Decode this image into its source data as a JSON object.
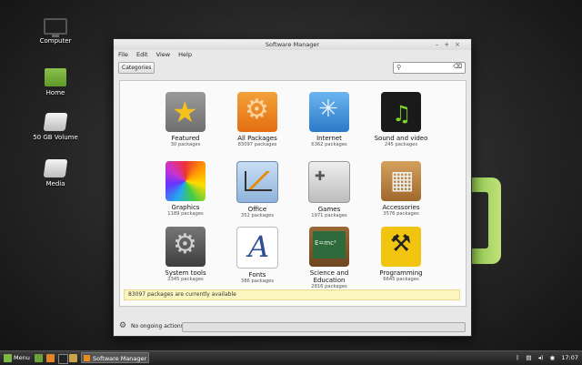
{
  "desktop": {
    "icons": [
      {
        "label": "Computer"
      },
      {
        "label": "Home"
      },
      {
        "label": "50 GB Volume"
      },
      {
        "label": "Media"
      }
    ]
  },
  "window": {
    "title": "Software Manager",
    "controls": [
      "–",
      "+",
      "×"
    ]
  },
  "menubar": {
    "items": [
      "File",
      "Edit",
      "View",
      "Help"
    ]
  },
  "toolbar": {
    "categories_label": "Categories",
    "search_placeholder": ""
  },
  "categories": [
    {
      "name": "Featured",
      "count": "30 packages"
    },
    {
      "name": "All Packages",
      "count": "83097 packages"
    },
    {
      "name": "Internet",
      "count": "6362 packages"
    },
    {
      "name": "Sound and video",
      "count": "245 packages"
    },
    {
      "name": "Graphics",
      "count": "1189 packages"
    },
    {
      "name": "Office",
      "count": "352 packages"
    },
    {
      "name": "Games",
      "count": "1971 packages"
    },
    {
      "name": "Accessories",
      "count": "3576 packages"
    },
    {
      "name": "System tools",
      "count": "2345 packages"
    },
    {
      "name": "Fonts",
      "count": "386 packages"
    },
    {
      "name": "Science and Education",
      "count": "2816 packages"
    },
    {
      "name": "Programming",
      "count": "6645 packages"
    }
  ],
  "status": {
    "text": "83097 packages are currently available"
  },
  "bottom": {
    "ongoing": "No ongoing actions"
  },
  "taskbar": {
    "menu_label": "Menu",
    "task_label": "Software Manager",
    "clock": "17:07"
  }
}
